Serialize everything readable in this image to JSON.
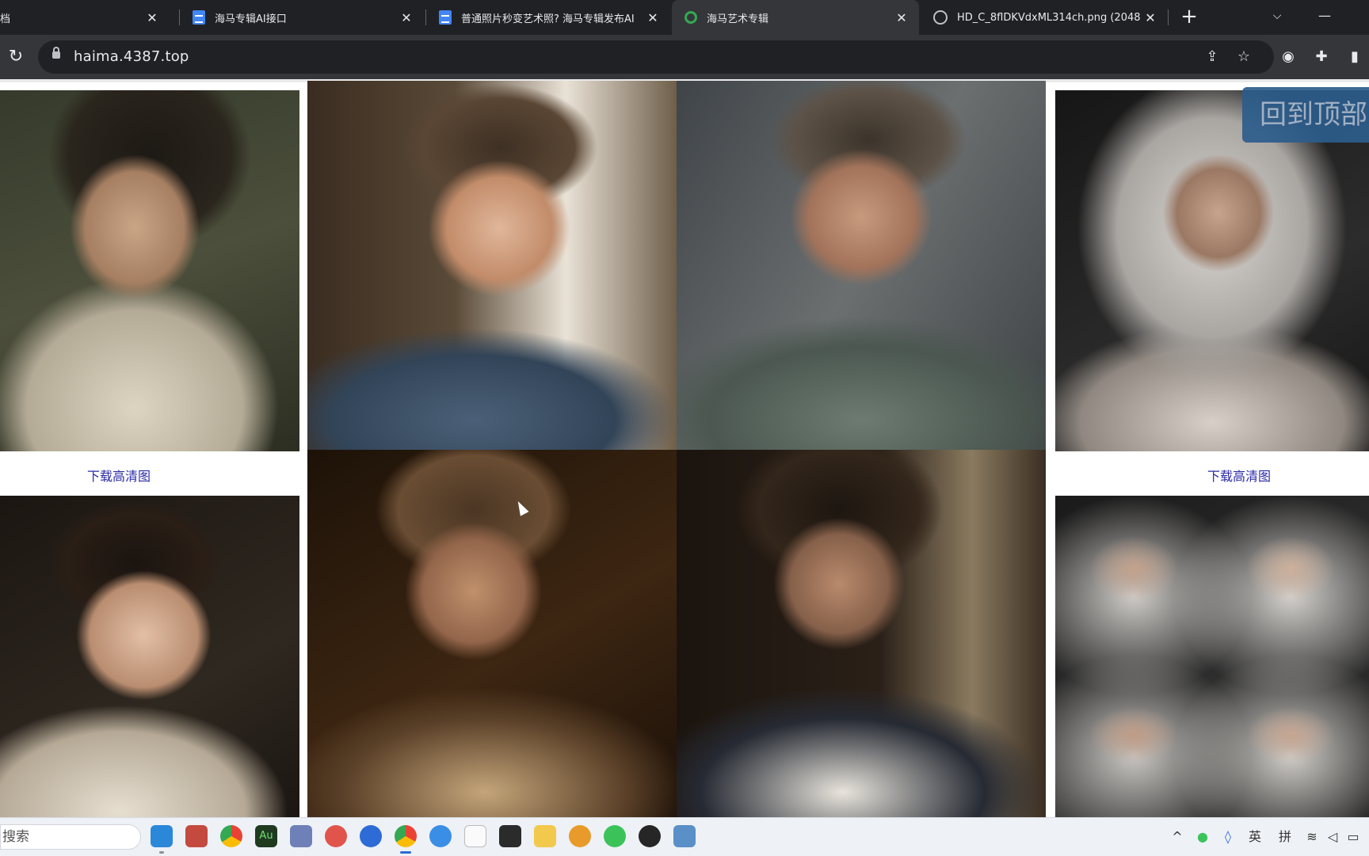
{
  "tabs": [
    {
      "title": "档",
      "icon": "doc-icon"
    },
    {
      "title": "海马专辑AI接口",
      "icon": "doc-icon"
    },
    {
      "title": "普通照片秒变艺术照? 海马专辑发布AI",
      "icon": "doc-icon"
    },
    {
      "title": "海马艺术专辑",
      "icon": "site-icon",
      "active": true
    },
    {
      "title": "HD_C_8flDKVdxML314ch.png (2048",
      "icon": "globe-icon"
    }
  ],
  "address": {
    "url": "haima.4387.top"
  },
  "gallery": {
    "download_label_left": "下载高清图",
    "download_label_right": "下载高清图",
    "back_to_top": "回到顶部"
  },
  "taskbar": {
    "search_placeholder": "搜索",
    "apps": [
      "vscode",
      "mail",
      "chrome",
      "audition",
      "network-tool",
      "pinwheel",
      "edge-like",
      "chrome-active",
      "check-app",
      "file",
      "terminal",
      "folder",
      "search-tool",
      "wechat",
      "obs",
      "picture"
    ],
    "tray": {
      "ime_lang": "英",
      "ime_mode": "拼"
    }
  }
}
